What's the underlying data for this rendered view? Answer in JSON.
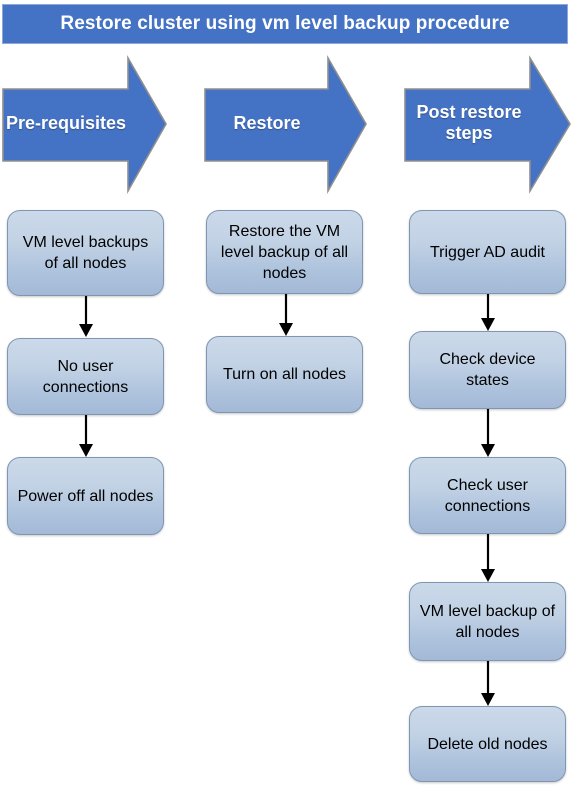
{
  "title": {
    "text": "Restore cluster using vm level backup procedure",
    "background_color": "#4472C4",
    "text_color": "#FFFFFF"
  },
  "theme": {
    "arrow_fill": "#4472C4",
    "arrow_stroke": "#8f8f8f",
    "box_fill_top": "#CBD9E9",
    "box_fill_bottom": "#A3B9D6",
    "box_stroke": "#7F96B3",
    "connector_color": "#000000",
    "box_text_color": "#000000"
  },
  "phases": [
    {
      "id": "pre-requisites",
      "label": "Pre-requisites",
      "steps": [
        {
          "id": "vm-level-backups-of-all-nodes",
          "text": "VM level backups of all nodes"
        },
        {
          "id": "no-user-connections",
          "text": "No user connections"
        },
        {
          "id": "power-off-all-nodes",
          "text": "Power off all nodes"
        }
      ]
    },
    {
      "id": "restore",
      "label": "Restore",
      "steps": [
        {
          "id": "restore-the-vm-level-backup-of-all-nodes",
          "text": "Restore the VM level backup of all nodes"
        },
        {
          "id": "turn-on-all-nodes",
          "text": "Turn on all nodes"
        }
      ]
    },
    {
      "id": "post-restore-steps",
      "label": "Post restore steps",
      "steps": [
        {
          "id": "trigger-ad-audit",
          "text": "Trigger AD audit"
        },
        {
          "id": "check-device-states",
          "text": "Check device states"
        },
        {
          "id": "check-user-connections",
          "text": "Check user connections"
        },
        {
          "id": "vm-level-backup-of-all-nodes",
          "text": "VM level backup of all nodes"
        },
        {
          "id": "delete-old-nodes",
          "text": "Delete old nodes"
        }
      ]
    }
  ]
}
